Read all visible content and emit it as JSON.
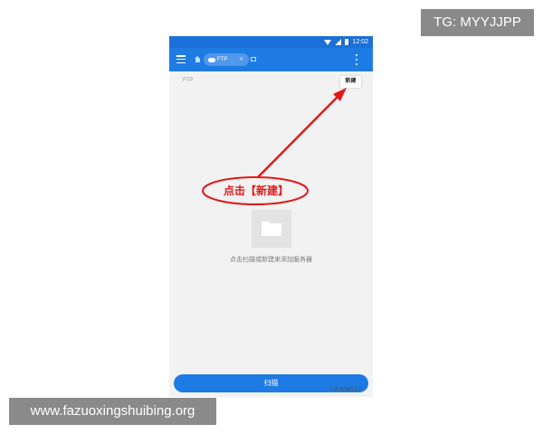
{
  "status_bar": {
    "time": "12:02"
  },
  "toolbar": {
    "tab_label": "FTP"
  },
  "location": {
    "path_label": "FTP"
  },
  "actions": {
    "new_label": "新建",
    "scan_label": "扫描"
  },
  "empty_state": {
    "message": "点击扫描或新建来添加服务器"
  },
  "annotation": {
    "label": "点击【新建】",
    "color": "#e21a1a"
  },
  "watermarks": {
    "top": "TG: MYYJJPP",
    "bottom": "www.fazuoxingshuibing.org",
    "credit": "头条 @旗帜达人"
  },
  "colors": {
    "accent": "#1e7be4",
    "status_bar": "#1b6fd8"
  }
}
